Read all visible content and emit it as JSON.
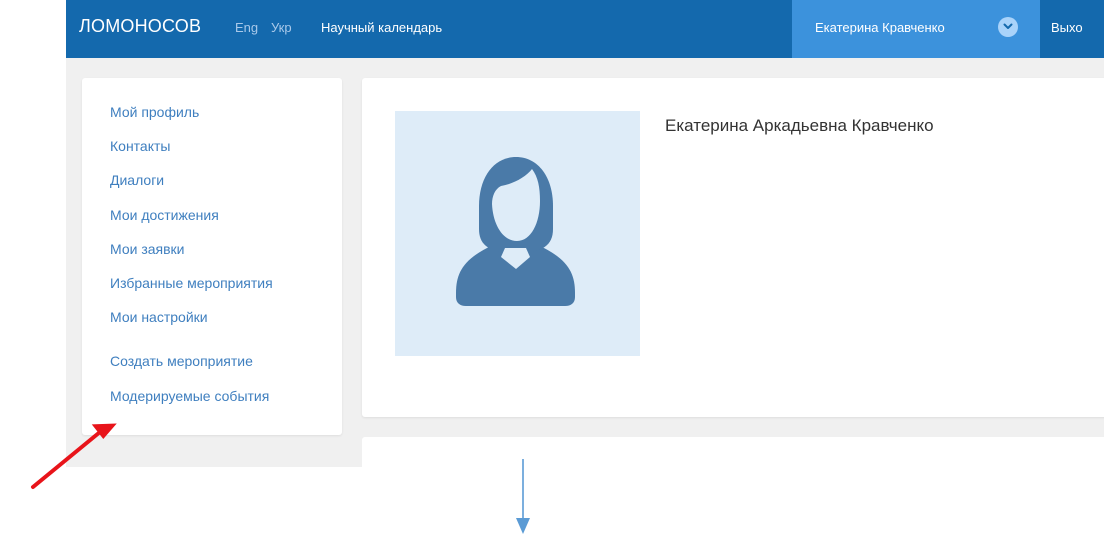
{
  "navbar": {
    "brand": "ЛОМОНОСОВ",
    "languages": [
      "Eng",
      "Укр"
    ],
    "calendar_link": "Научный календарь",
    "user_name": "Екатерина Кравченко",
    "logout": "Выхо"
  },
  "sidebar": {
    "items": [
      {
        "label": "Мой профиль"
      },
      {
        "label": "Контакты"
      },
      {
        "label": "Диалоги"
      },
      {
        "label": "Мои достижения"
      },
      {
        "label": "Мои заявки"
      },
      {
        "label": "Избранные мероприятия"
      },
      {
        "label": "Мои настройки"
      },
      {
        "label": "Создать мероприятие"
      },
      {
        "label": "Модерируемые события"
      }
    ]
  },
  "profile": {
    "full_name": "Екатерина Аркадьевна Кравченко",
    "avatar_icon": "female-avatar-icon"
  },
  "annotations": {
    "red_arrow_color": "#e8141a",
    "blue_arrow_color": "#5b9bd5"
  },
  "colors": {
    "navbar": "#1469ad",
    "user_block": "#3c92dc",
    "link": "#3f7fbf",
    "avatar_bg": "#deecf8",
    "avatar_fg": "#4a7aa8"
  }
}
